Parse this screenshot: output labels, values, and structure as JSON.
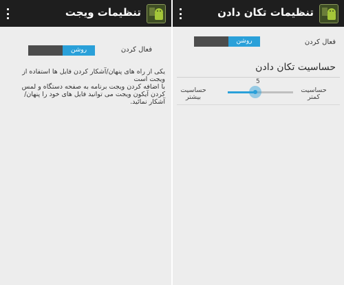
{
  "left": {
    "title": "تنظیمات ویجت",
    "enable_label": "فعال کردن",
    "toggle": {
      "on_label": "روشن",
      "state": "on"
    },
    "description": [
      "یکی از راه های پنهان/آشکار کردن فایل ها استفاده از ویجت است",
      "با اضافه کردن ویجت برنامه به صفحه دستگاه و لمس کردن آیکون ویجت می توانید فایل های خود را پنهان/آشکار نمائید."
    ]
  },
  "right": {
    "title": "تنظیمات تکان دادن",
    "enable_label": "فعال کردن",
    "toggle": {
      "on_label": "روشن",
      "state": "on"
    },
    "sensitivity_title": "حساسیت تکان دادن",
    "slider": {
      "value": "5",
      "level": 0.42,
      "min_caption": "حساسیت کمتر",
      "max_caption": "حساسیت بیشتر"
    }
  },
  "colors": {
    "accent": "#2aa0d9",
    "actionbar": "#1e1e1e",
    "background": "#ededed"
  },
  "icons": {
    "menu": "overflow-menu-icon",
    "app": "android-app-icon"
  }
}
